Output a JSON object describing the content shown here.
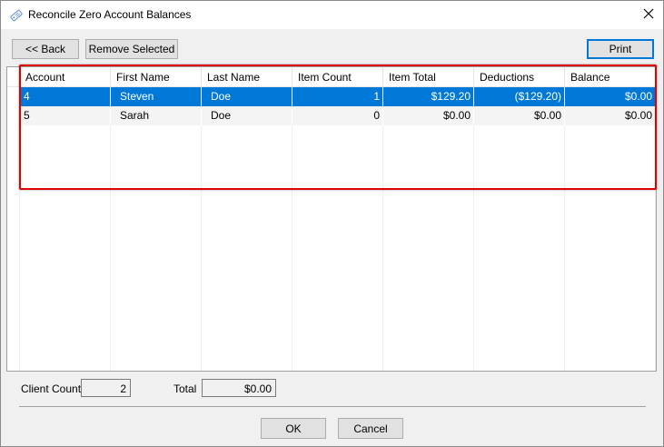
{
  "window": {
    "title": "Reconcile Zero Account Balances",
    "close_glyph": "✕",
    "title_icon": "tag-icon"
  },
  "toolbar": {
    "back_label": "<< Back",
    "remove_label": "Remove Selected",
    "print_label": "Print"
  },
  "grid": {
    "columns": [
      "Account",
      "First Name",
      "Last Name",
      "Item Count",
      "Item Total",
      "Deductions",
      "Balance"
    ],
    "rows": [
      {
        "account": "4",
        "first_name": "Steven",
        "last_name": "Doe",
        "item_count": "1",
        "item_total": "$129.20",
        "deductions": "($129.20)",
        "balance": "$0.00",
        "selected": true
      },
      {
        "account": "5",
        "first_name": "Sarah",
        "last_name": "Doe",
        "item_count": "0",
        "item_total": "$0.00",
        "deductions": "$0.00",
        "balance": "$0.00",
        "selected": false
      }
    ]
  },
  "summary": {
    "client_count_label": "Client Count",
    "client_count_value": "2",
    "total_label": "Total",
    "total_value": "$0.00"
  },
  "footer": {
    "ok_label": "OK",
    "cancel_label": "Cancel"
  },
  "colors": {
    "selection": "#0078d7",
    "highlight_border": "#e00000"
  }
}
